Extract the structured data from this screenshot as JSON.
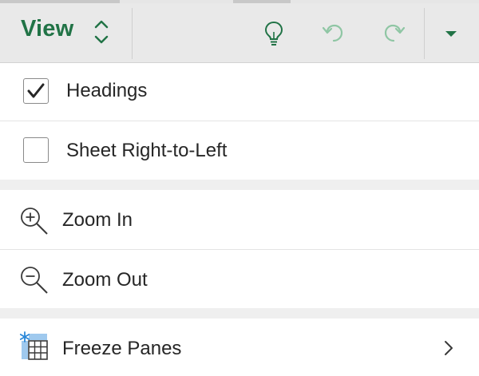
{
  "toolbar": {
    "title": "View",
    "switch_icon": "chevron-up-down-icon",
    "tell_me_icon": "lightbulb-icon",
    "undo_icon": "undo-icon",
    "redo_icon": "redo-icon",
    "more_icon": "caret-down-icon"
  },
  "menu": {
    "items": [
      {
        "label": "Headings",
        "type": "checkbox",
        "checked": true
      },
      {
        "label": "Sheet Right-to-Left",
        "type": "checkbox",
        "checked": false
      },
      {
        "label": "Zoom In",
        "type": "action",
        "icon": "zoom-in-icon"
      },
      {
        "label": "Zoom Out",
        "type": "action",
        "icon": "zoom-out-icon"
      },
      {
        "label": "Freeze Panes",
        "type": "submenu",
        "icon": "freeze-panes-icon"
      }
    ]
  },
  "colors": {
    "accent": "#217346",
    "icon_blue": "#2b88d8",
    "toolbar_bg": "#e9e9e9",
    "text": "#262626"
  }
}
